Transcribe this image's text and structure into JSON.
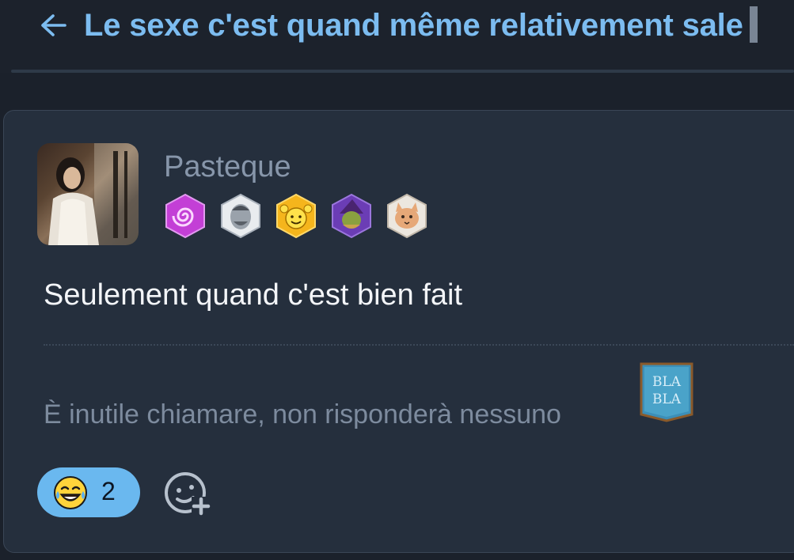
{
  "header": {
    "title": "Le sexe c'est quand même relativement sale",
    "back_icon": "arrow-left-icon"
  },
  "post": {
    "username": "Pasteque",
    "avatar_icon": "user-avatar",
    "badges": [
      {
        "name": "spiral-badge-icon",
        "color": "#c33fd6"
      },
      {
        "name": "man-face-badge-icon",
        "color": "#b8bec6"
      },
      {
        "name": "smiley-hands-badge-icon",
        "color": "#f5b51c"
      },
      {
        "name": "wizard-badge-icon",
        "color": "#6b3db5"
      },
      {
        "name": "cat-badge-icon",
        "color": "#d8d2c8"
      }
    ],
    "message": "Seulement quand c'est bien fait",
    "signature": "È inutile chiamare, non risponderà nessuno",
    "signature_badge_text": [
      "BLA",
      "BLA"
    ]
  },
  "reactions": {
    "items": [
      {
        "emoji": "laughing-tears-icon",
        "count": "2"
      }
    ],
    "add_icon": "add-reaction-icon"
  },
  "colors": {
    "accent": "#7cbcf0",
    "card_bg": "#252f3d",
    "page_bg": "#1b212b",
    "reaction_pill": "#6ab8ef"
  }
}
